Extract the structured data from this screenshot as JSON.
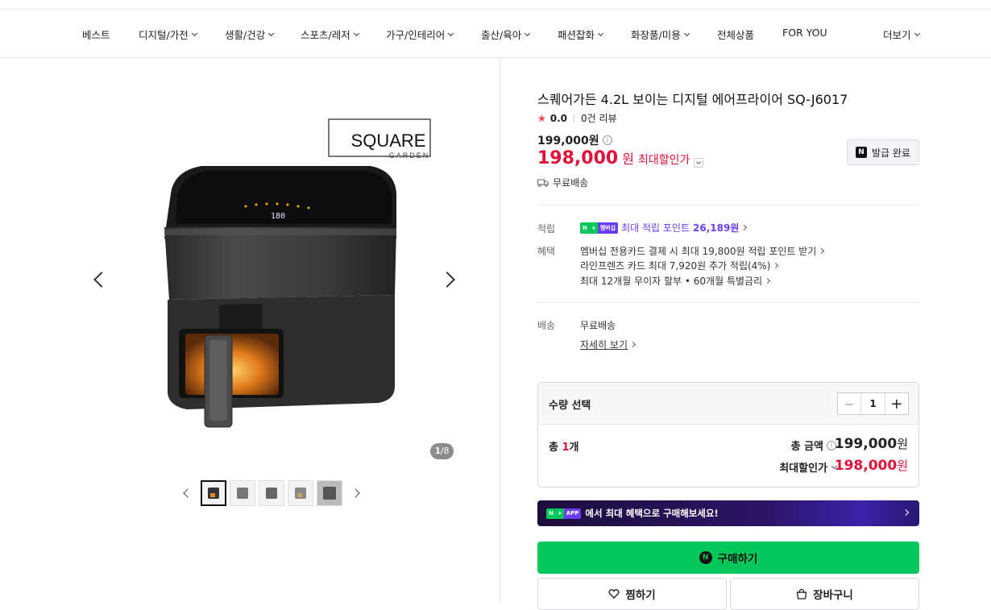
{
  "nav": {
    "items": [
      {
        "label": "베스트",
        "chev": false
      },
      {
        "label": "디지털/가전",
        "chev": true
      },
      {
        "label": "생활/건강",
        "chev": true
      },
      {
        "label": "스포츠/레저",
        "chev": true
      },
      {
        "label": "가구/인테리어",
        "chev": true
      },
      {
        "label": "출산/육아",
        "chev": true
      },
      {
        "label": "패션잡화",
        "chev": true
      },
      {
        "label": "화장품/미용",
        "chev": true
      },
      {
        "label": "전체상품",
        "chev": false
      },
      {
        "label": "FOR YOU",
        "chev": false
      }
    ],
    "more_label": "더보기"
  },
  "gallery": {
    "brand_logo_text": "SQUARE",
    "brand_logo_sub": "GARDEN",
    "display_readout": "180",
    "counter_current": "1",
    "counter_total": "/8",
    "thumb_count": 5,
    "selected_thumb": 1
  },
  "product": {
    "title": "스퀘어가든 4.2L 보이는 디지털 에어프라이어 SQ-J6017",
    "rating": "0.0",
    "reviews": "0건 리뷰",
    "original_price": "199,000원",
    "sale_price": "198,000",
    "sale_won": "원",
    "sale_label": "최대할인가",
    "coupon_label": "발급 완료",
    "shipping": "무료배송"
  },
  "benefits": {
    "points_label": "적립",
    "badge_n": "N",
    "badge_plus": "+",
    "badge_member": "멤버십",
    "points_text": "최대 적립 포인트",
    "points_value": "26,189원",
    "benefit_label": "혜택",
    "lines": [
      "멤버십 전용카드 결제 시 최대 19,800원 적립 포인트 받기",
      "라인프렌즈 카드 최대 7,920원 추가 적립(4%)",
      "최대 12개월 무이자 할부 • 60개월 특별금리"
    ],
    "delivery_label": "배송",
    "delivery_value": "무료배송",
    "delivery_detail": "자세히 보기"
  },
  "quantity": {
    "title": "수량 선택",
    "value": "1",
    "minus": "−",
    "plus": "+",
    "count_prefix": "총 ",
    "count_num": "1",
    "count_suffix": "개",
    "total_label": "총 금액",
    "total_value": "199,000",
    "total_won": "원",
    "max_label": "최대할인가",
    "max_value": "198,000",
    "max_won": "원"
  },
  "banner": {
    "badge_n": "N",
    "badge_plus": "+",
    "badge_app": "APP",
    "text": "에서 최대 혜택으로 구매해보세요!"
  },
  "actions": {
    "buy": "구매하기",
    "buy_icon": "N",
    "wish": "찜하기",
    "cart": "장바구니"
  },
  "colors": {
    "accent_red": "#e0113a",
    "naver_green": "#03c75a",
    "membership_purple": "#6a3df2"
  }
}
